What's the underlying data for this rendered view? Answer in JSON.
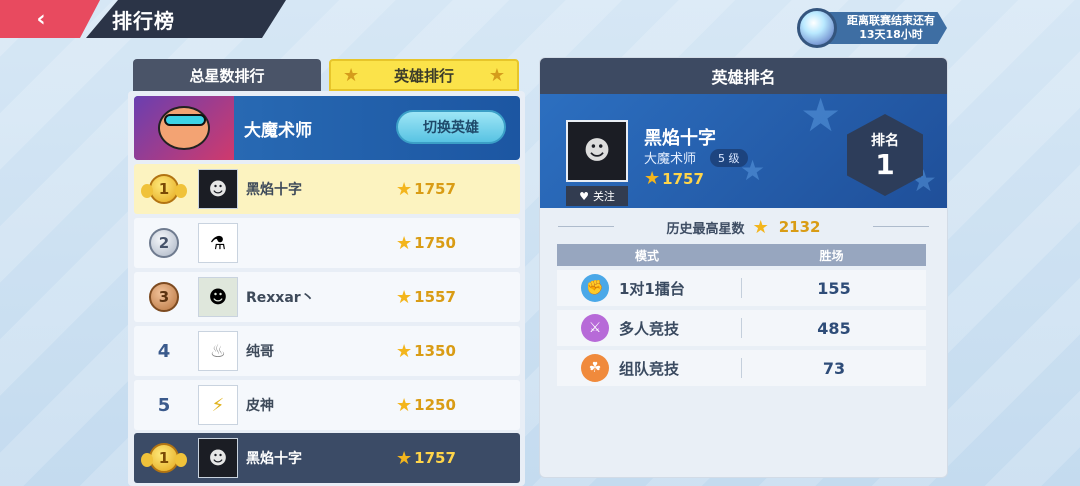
{
  "header": {
    "title": "排行榜"
  },
  "season": {
    "line1": "距离联赛结束还有",
    "line2": "13天18小时"
  },
  "tabs": {
    "stars_label": "总星数排行",
    "hero_label": "英雄排行"
  },
  "hero_banner": {
    "hero_name": "大魔术师",
    "switch_label": "切换英雄"
  },
  "rankings": [
    {
      "rank": "1",
      "name": "黑焰十字",
      "stars": "1757"
    },
    {
      "rank": "2",
      "name": "",
      "stars": "1750"
    },
    {
      "rank": "3",
      "name": "Rexxar丶",
      "stars": "1557"
    },
    {
      "rank": "4",
      "name": "纯哥",
      "stars": "1350"
    },
    {
      "rank": "5",
      "name": "皮神",
      "stars": "1250"
    }
  ],
  "my_rank": {
    "rank": "1",
    "name": "黑焰十字",
    "stars": "1757"
  },
  "detail": {
    "header": "英雄排名",
    "player_name": "黑焰十字",
    "hero_name": "大魔术师",
    "level": "5 级",
    "stars": "1757",
    "follow_label": "关注",
    "rank_label": "排名",
    "rank_value": "1",
    "history_label": "历史最高星数",
    "history_value": "2132",
    "col_mode": "模式",
    "col_wins": "胜场",
    "modes": [
      {
        "name": "1对1擂台",
        "wins": "155",
        "color": "#4aa8e8",
        "icon": "fist-icon"
      },
      {
        "name": "多人竞技",
        "wins": "485",
        "color": "#b76ad8",
        "icon": "swords-icon"
      },
      {
        "name": "组队竞技",
        "wins": "73",
        "color": "#f08a3c",
        "icon": "handshake-icon"
      }
    ]
  }
}
